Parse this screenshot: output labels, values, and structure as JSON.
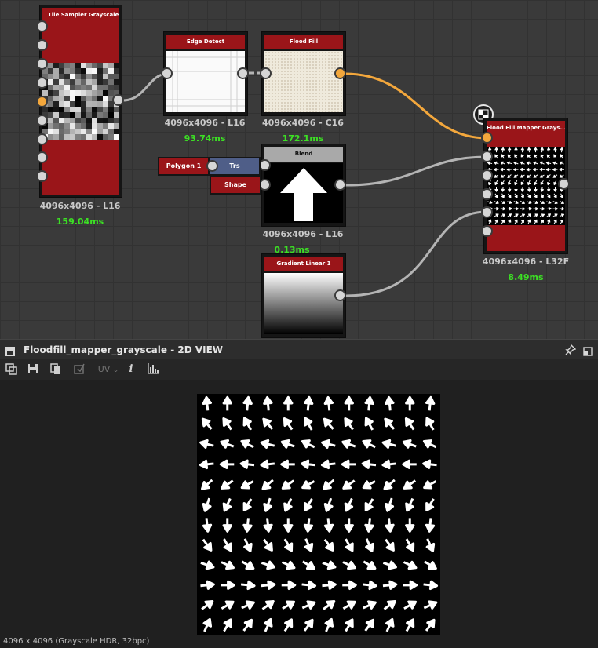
{
  "graph": {
    "nodes": {
      "tile_sampler": {
        "title": "Tile Sampler Grayscale",
        "resolution": "4096x4096 - L16",
        "time": "159.04ms"
      },
      "edge_detect": {
        "title": "Edge Detect",
        "resolution": "4096x4096 - L16",
        "time": "93.74ms"
      },
      "flood_fill": {
        "title": "Flood Fill",
        "resolution": "4096x4096 - C16",
        "time": "172.1ms"
      },
      "blend": {
        "title": "Blend",
        "resolution": "4096x4096 - L16",
        "time": "0.13ms"
      },
      "gradient_linear": {
        "title": "Gradient Linear 1"
      },
      "flood_fill_mapper": {
        "title": "Flood Fill Mapper Grays...",
        "resolution": "4096x4096 - L32F",
        "time": "8.49ms"
      }
    },
    "tags": {
      "polygon": "Polygon 1",
      "trs": "Trs",
      "shape": "Shape"
    }
  },
  "panel": {
    "title": "Floodfill_mapper_grayscale - 2D VIEW",
    "toolbar": {
      "uv_label": "UV",
      "uv_caret": "⌄",
      "info_label": "i"
    },
    "status": "4096 x 4096 (Grayscale HDR, 32bpc)"
  },
  "colors": {
    "node_header": "#9a1519",
    "ms_green": "#3ce024",
    "wire_active": "#f3a73c",
    "wire": "#b4b4b4",
    "trs_blue": "#4f5e88"
  },
  "icons": [
    "pin-icon",
    "maximize-icon",
    "grid-icon",
    "save-icon",
    "copy-icon",
    "export-icon",
    "info-icon",
    "histogram-icon"
  ]
}
